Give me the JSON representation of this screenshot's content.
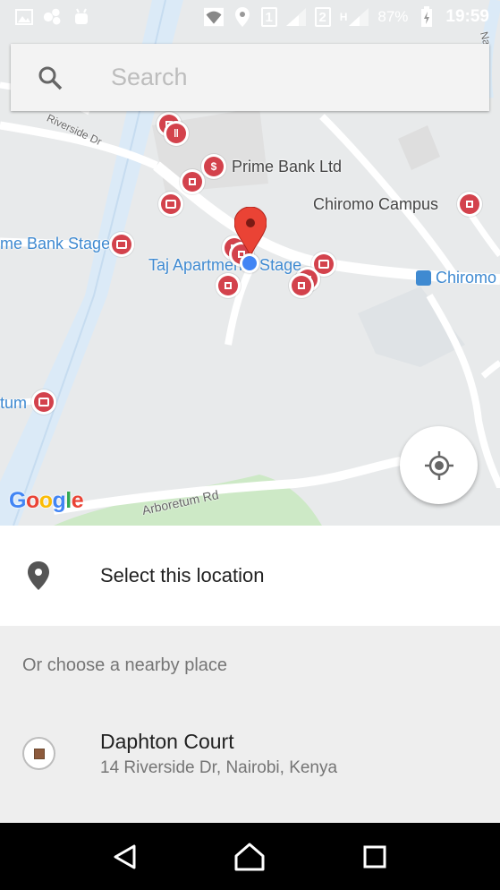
{
  "status_bar": {
    "sim1": "1",
    "sim2": "2",
    "network_type": "H",
    "battery": "87%",
    "time": "19:59"
  },
  "search": {
    "placeholder": "Search"
  },
  "map": {
    "labels": {
      "riverside_dr": "Riverside Dr",
      "prime_bank": "Prime Bank Ltd",
      "chiromo_campus": "Chiromo Campus",
      "prime_bank_stage": "me Bank Stage",
      "taj_apartments": "Taj Apartments Stage",
      "chiromo": "Chiromo",
      "arboretum_partial": "tum",
      "arboretum_rd": "Arboretum Rd",
      "road_top_right": "Na"
    },
    "google_logo": [
      "G",
      "o",
      "o",
      "g",
      "l",
      "e"
    ]
  },
  "select_location": {
    "label": "Select this location"
  },
  "nearby": {
    "header": "Or choose a nearby place",
    "places": [
      {
        "name": "Daphton Court",
        "address": "14 Riverside Dr, Nairobi, Kenya"
      }
    ]
  },
  "colors": {
    "poi_red": "#d3424c",
    "map_bg": "#e8eaeb",
    "road": "#ffffff",
    "highway": "#dbeaf7",
    "park": "#cde9c6",
    "location_blue": "#4285f4",
    "marker_red": "#ea4335"
  }
}
